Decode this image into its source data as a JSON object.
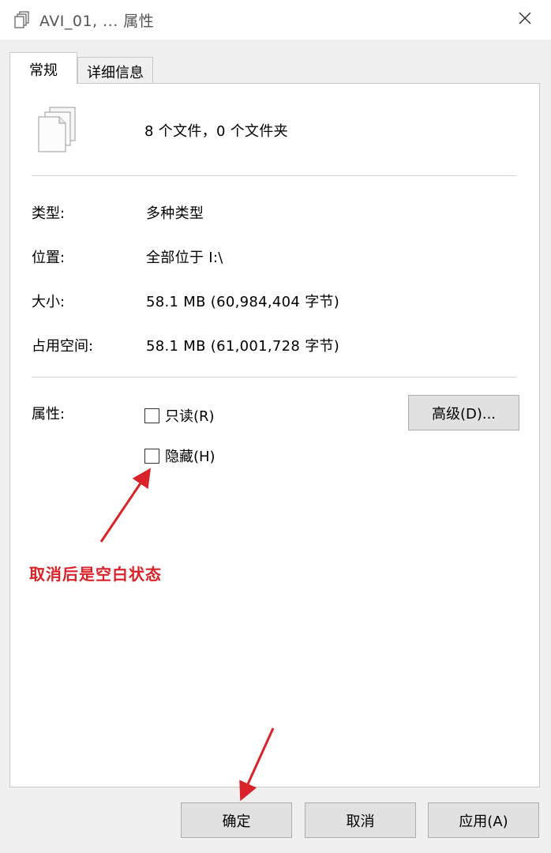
{
  "window": {
    "title": "AVI_01, ... 属性",
    "title_icon": "files-icon",
    "close_icon": "close-icon"
  },
  "tabs": [
    {
      "label": "常规",
      "active": true
    },
    {
      "label": "详细信息",
      "active": false
    }
  ],
  "general": {
    "file_icon": "multiple-files-icon",
    "summary": "8 个文件，0 个文件夹",
    "properties": [
      {
        "label": "类型:",
        "value": "多种类型"
      },
      {
        "label": "位置:",
        "value": "全部位于 I:\\"
      },
      {
        "label": "大小:",
        "value": "58.1 MB (60,984,404 字节)"
      },
      {
        "label": "占用空间:",
        "value": "58.1 MB (61,001,728 字节)"
      }
    ],
    "attributes_label": "属性:",
    "attributes": [
      {
        "label": "只读(R)",
        "checked": false
      },
      {
        "label": "隐藏(H)",
        "checked": false
      }
    ],
    "advanced_button": "高级(D)..."
  },
  "annotation": {
    "text": "取消后是空白状态",
    "color": "#d9232a"
  },
  "buttons": {
    "ok": "确定",
    "cancel": "取消",
    "apply": "应用(A)"
  }
}
